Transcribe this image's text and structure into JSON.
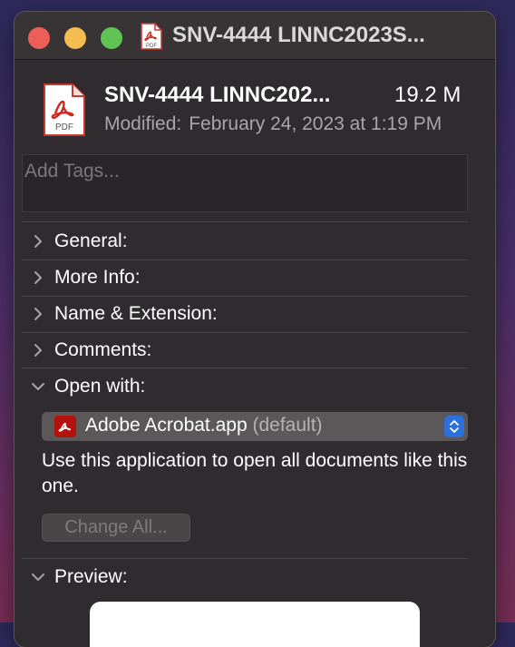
{
  "window": {
    "title": "SNV-4444 LINNC2023S...",
    "title_icon": "pdf-file-icon"
  },
  "file": {
    "name": "SNV-4444 LINNC202...",
    "size": "19.2 M",
    "modified_label": "Modified:",
    "modified_value": "February 24, 2023 at 1:19 PM",
    "icon": "pdf-document-icon"
  },
  "tags": {
    "placeholder": "Add Tags..."
  },
  "sections": {
    "general": "General:",
    "more_info": "More Info:",
    "name_extension": "Name & Extension:",
    "comments": "Comments:",
    "open_with": "Open with:",
    "preview": "Preview:"
  },
  "open_with": {
    "app_name": "Adobe Acrobat.app",
    "app_default": "(default)",
    "app_icon": "acrobat-icon",
    "description": "Use this application to open all documents like this one.",
    "change_all_label": "Change All..."
  },
  "colors": {
    "window_bg": "#2f2b2e",
    "close": "#ec5f57",
    "minimize": "#f4bd4f",
    "zoom": "#5fc454",
    "acrobat_red": "#b3120d",
    "accent_blue": "#2d6fdc"
  }
}
